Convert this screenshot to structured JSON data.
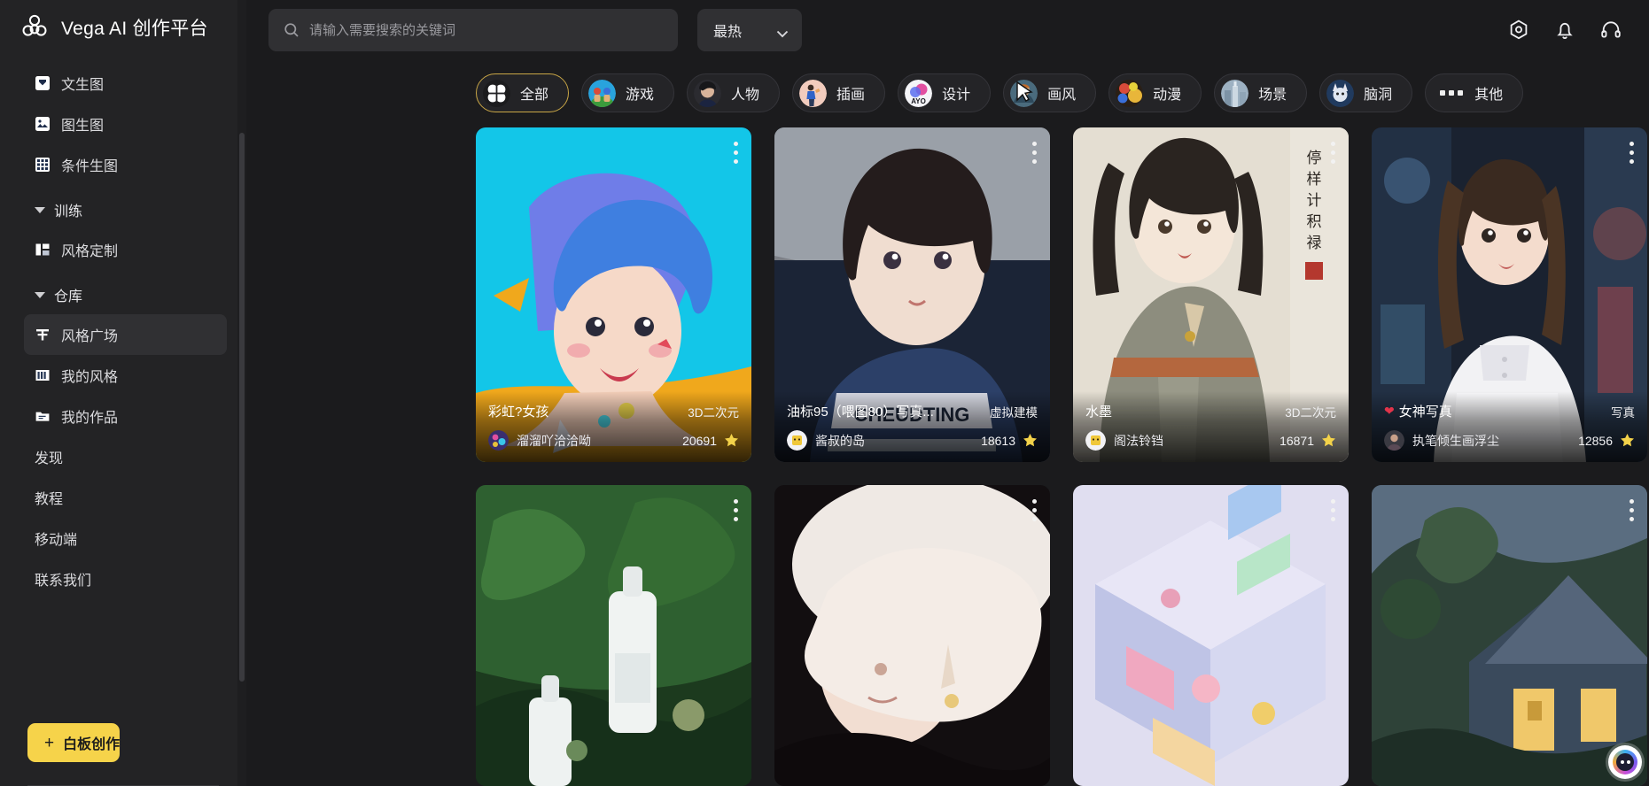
{
  "brand": {
    "title": "Vega AI 创作平台",
    "logo_icon": "flower-logo-icon"
  },
  "sidebar": {
    "items": [
      {
        "label": "文生图",
        "icon": "text-to-image-icon",
        "type": "item"
      },
      {
        "label": "图生图",
        "icon": "image-to-image-icon",
        "type": "item"
      },
      {
        "label": "条件生图",
        "icon": "conditional-image-icon",
        "type": "item"
      },
      {
        "label": "训练",
        "icon": "chevron-down-icon",
        "type": "group"
      },
      {
        "label": "风格定制",
        "icon": "style-custom-icon",
        "type": "item"
      },
      {
        "label": "仓库",
        "icon": "chevron-down-icon",
        "type": "group"
      },
      {
        "label": "风格广场",
        "icon": "style-plaza-icon",
        "type": "item",
        "active": true
      },
      {
        "label": "我的风格",
        "icon": "my-style-icon",
        "type": "item"
      },
      {
        "label": "我的作品",
        "icon": "my-works-icon",
        "type": "item"
      },
      {
        "label": "发现",
        "icon": "",
        "type": "plain"
      },
      {
        "label": "教程",
        "icon": "",
        "type": "plain"
      },
      {
        "label": "移动端",
        "icon": "",
        "type": "plain"
      },
      {
        "label": "联系我们",
        "icon": "",
        "type": "plain"
      }
    ],
    "whiteboard_button": {
      "label": "白板创作",
      "plus": "+",
      "color": "#f6d34a"
    }
  },
  "topbar": {
    "search": {
      "placeholder": "请输入需要搜索的关键词",
      "value": "",
      "icon": "search-icon"
    },
    "sort": {
      "value": "最热",
      "icon": "chevron-down-icon"
    },
    "actions": [
      {
        "name": "settings-icon",
        "label": "设置"
      },
      {
        "name": "bell-icon",
        "label": "通知"
      },
      {
        "name": "headset-icon",
        "label": "客服"
      }
    ]
  },
  "chips": [
    {
      "label": "全部",
      "icon": "grid-clover-icon",
      "selected": true,
      "accent": "#c9a646"
    },
    {
      "label": "游戏",
      "icon": "game-avatar-icon",
      "selected": false,
      "accent": "#3b8f3b"
    },
    {
      "label": "人物",
      "icon": "person-avatar-icon",
      "selected": false,
      "accent": "#55585e"
    },
    {
      "label": "插画",
      "icon": "illustration-avatar-icon",
      "selected": false,
      "accent": "#e8b6a8"
    },
    {
      "label": "设计",
      "icon": "design-avatar-icon",
      "selected": false,
      "accent": "#e8e8ee"
    },
    {
      "label": "画风",
      "icon": "artstyle-avatar-icon",
      "selected": false,
      "accent": "#4e6f86"
    },
    {
      "label": "动漫",
      "icon": "anime-avatar-icon",
      "selected": false,
      "accent": "#d8a63a"
    },
    {
      "label": "场景",
      "icon": "scene-avatar-icon",
      "selected": false,
      "accent": "#8fa3b5"
    },
    {
      "label": "脑洞",
      "icon": "idea-avatar-icon",
      "selected": false,
      "accent": "#2f4f79"
    },
    {
      "label": "其他",
      "icon": "dots-horizontal-icon",
      "selected": false,
      "accent": "#efefef"
    }
  ],
  "cards": [
    {
      "title": "彩虹?女孩",
      "heart": false,
      "tag": "3D二次元",
      "author": "溜溜吖洽洽呦",
      "likes": "20691",
      "menu_icon": "more-vertical-icon",
      "like_icon": "star-icon",
      "row": 1,
      "theme": "rainbow-girl"
    },
    {
      "title": "油标95（喂图80）写真...",
      "heart": false,
      "tag": "虚拟建模",
      "author": "酱叔的岛",
      "likes": "18613",
      "menu_icon": "more-vertical-icon",
      "like_icon": "star-icon",
      "row": 1,
      "theme": "racing-girl"
    },
    {
      "title": "水墨",
      "heart": false,
      "tag": "3D二次元",
      "author": "阁法铃铛",
      "likes": "16871",
      "menu_icon": "more-vertical-icon",
      "like_icon": "star-icon",
      "row": 1,
      "theme": "ink-wash"
    },
    {
      "title": "女神写真",
      "heart": true,
      "tag": "写真",
      "author": "执笔倾生画浮尘",
      "likes": "12856",
      "menu_icon": "more-vertical-icon",
      "like_icon": "star-icon",
      "row": 1,
      "theme": "city-night"
    },
    {
      "title": "",
      "heart": false,
      "tag": "",
      "author": "",
      "likes": "",
      "menu_icon": "more-vertical-icon",
      "like_icon": "star-icon",
      "row": 2,
      "theme": "product-green"
    },
    {
      "title": "",
      "heart": false,
      "tag": "",
      "author": "",
      "likes": "",
      "menu_icon": "more-vertical-icon",
      "like_icon": "star-icon",
      "row": 2,
      "theme": "white-hair"
    },
    {
      "title": "",
      "heart": false,
      "tag": "",
      "author": "",
      "likes": "",
      "menu_icon": "more-vertical-icon",
      "like_icon": "star-icon",
      "row": 2,
      "theme": "isometric-room"
    },
    {
      "title": "",
      "heart": false,
      "tag": "",
      "author": "",
      "likes": "",
      "menu_icon": "more-vertical-icon",
      "like_icon": "star-icon",
      "row": 2,
      "theme": "cabin-night"
    }
  ],
  "float_widget": {
    "icon": "assistant-bubble-icon"
  },
  "colors": {
    "sidebar_bg": "#232325",
    "page_bg": "#1b1b1d",
    "field_bg": "#303033",
    "accent_yellow": "#f6d34a",
    "chip_border_selected": "#c9a646"
  }
}
